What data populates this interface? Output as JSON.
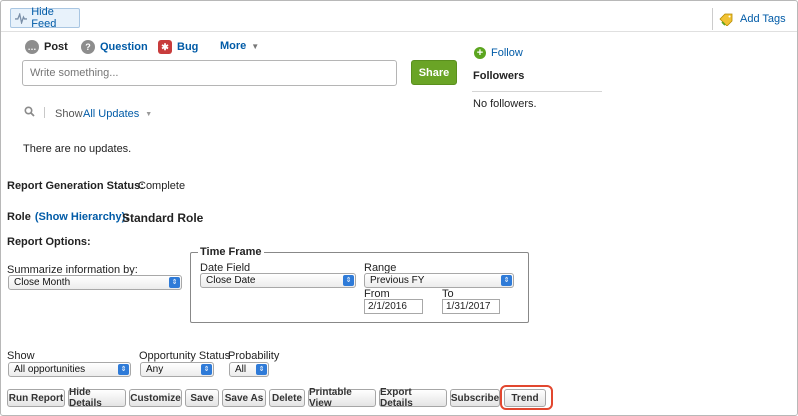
{
  "topbar": {
    "hide_feed": "Hide Feed",
    "add_tags": "Add Tags"
  },
  "publisher": {
    "tabs": [
      "Post",
      "Question",
      "Bug"
    ],
    "more": "More",
    "placeholder": "Write something...",
    "share": "Share"
  },
  "followers": {
    "follow": "Follow",
    "heading": "Followers",
    "empty": "No followers."
  },
  "feed_filter": {
    "show_label": "Show",
    "selected": "All Updates"
  },
  "no_updates": "There are no updates.",
  "report": {
    "status_label": "Report Generation Status:",
    "status_value": "Complete",
    "role_label": "Role",
    "show_hierarchy": "(Show Hierarchy)",
    "role_colon": ":",
    "role_value": "Standard Role",
    "options_label": "Report Options:",
    "summarize_label": "Summarize information by:",
    "summarize_value": "Close Month"
  },
  "timeframe": {
    "legend": "Time Frame",
    "date_field_label": "Date Field",
    "date_field_value": "Close Date",
    "range_label": "Range",
    "range_value": "Previous FY",
    "from_label": "From",
    "from_value": "2/1/2016",
    "to_label": "To",
    "to_value": "1/31/2017"
  },
  "filters": {
    "show_label": "Show",
    "show_value": "All opportunities",
    "status_label": "Opportunity Status",
    "status_value": "Any",
    "probability_label": "Probability",
    "probability_value": "All"
  },
  "buttons": [
    "Run Report",
    "Hide Details",
    "Customize",
    "Save",
    "Save As",
    "Delete",
    "Printable View",
    "Export Details",
    "Subscribe",
    "Trend"
  ],
  "colors": {
    "link": "#015ba7",
    "share_green": "#6aa426",
    "highlight": "#e2472f",
    "select_arrow": "#2f7bd8"
  }
}
